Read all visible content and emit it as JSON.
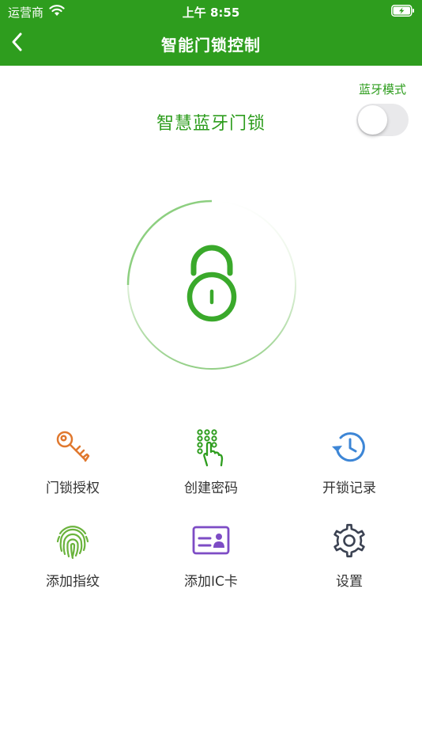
{
  "status_bar": {
    "carrier": "运营商",
    "time": "上午 8:55"
  },
  "nav": {
    "title": "智能门锁控制"
  },
  "bluetooth": {
    "mode_label": "蓝牙模式",
    "enabled": false
  },
  "lock": {
    "title": "智慧蓝牙门锁"
  },
  "functions": [
    {
      "label": "门锁授权",
      "icon": "key-icon",
      "color": "#e0782e"
    },
    {
      "label": "创建密码",
      "icon": "keypad-icon",
      "color": "#2e9d1e"
    },
    {
      "label": "开锁记录",
      "icon": "history-icon",
      "color": "#3d86d6"
    },
    {
      "label": "添加指纹",
      "icon": "fingerprint-icon",
      "color": "#6ab33c"
    },
    {
      "label": "添加IC卡",
      "icon": "id-card-icon",
      "color": "#7d4cc5"
    },
    {
      "label": "设置",
      "icon": "gear-icon",
      "color": "#3b4252"
    }
  ],
  "colors": {
    "brand": "#2e9d1e"
  }
}
